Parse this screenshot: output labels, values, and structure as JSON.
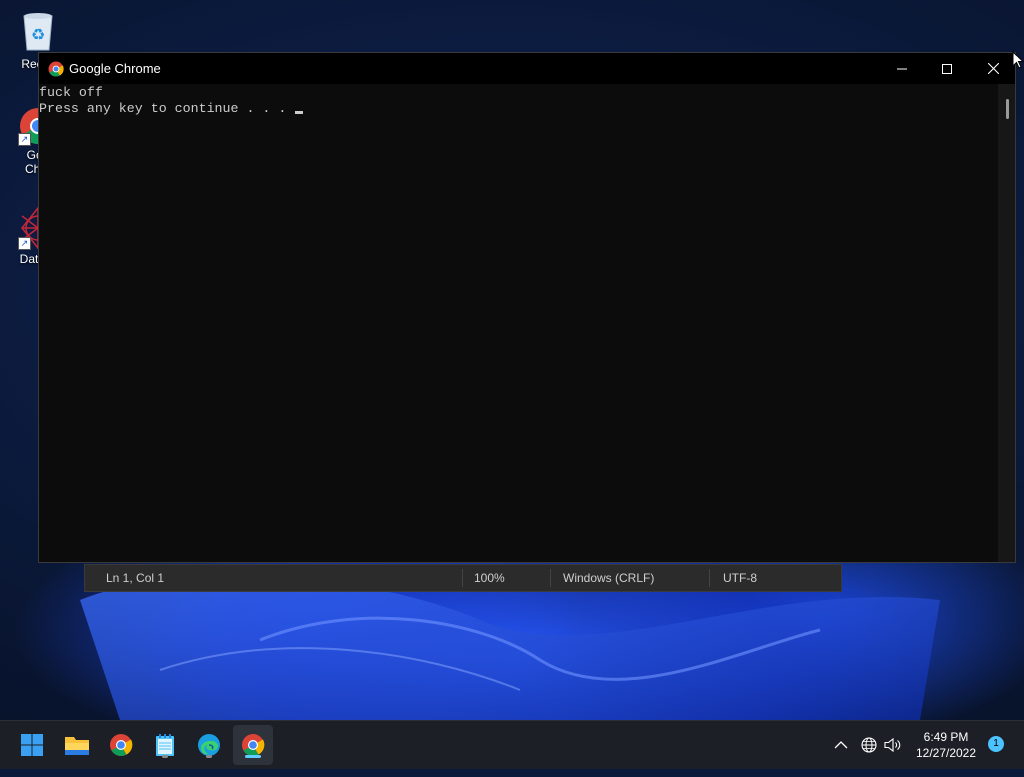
{
  "desktop": {
    "icons": [
      {
        "label": "Recyc",
        "icon": "recycle-bin-icon"
      },
      {
        "label_line1": "Goo",
        "label_line2": "Chro",
        "icon": "chrome-icon"
      },
      {
        "label": "DataW",
        "icon": "datawrapper-icon"
      }
    ]
  },
  "window": {
    "title": "Google Chrome",
    "console_lines": [
      "fuck off",
      "Press any key to continue . . . "
    ],
    "buttons": {
      "minimize": "minimize-icon",
      "maximize": "maximize-icon",
      "close": "close-icon"
    }
  },
  "statusbar": {
    "position": "Ln 1, Col 1",
    "zoom": "100%",
    "line_ending": "Windows (CRLF)",
    "encoding": "UTF-8"
  },
  "taskbar": {
    "apps": [
      "start-icon",
      "file-explorer-icon",
      "chrome-icon",
      "notepad-icon",
      "edge-icon",
      "chrome-active-icon"
    ],
    "time": "6:49 PM",
    "date": "12/27/2022",
    "notification_count": "1"
  },
  "colors": {
    "console_bg": "#0c0c0c",
    "console_text": "#cccccc",
    "taskbar_bg": "#1c1f26",
    "accent": "#60cdff"
  }
}
